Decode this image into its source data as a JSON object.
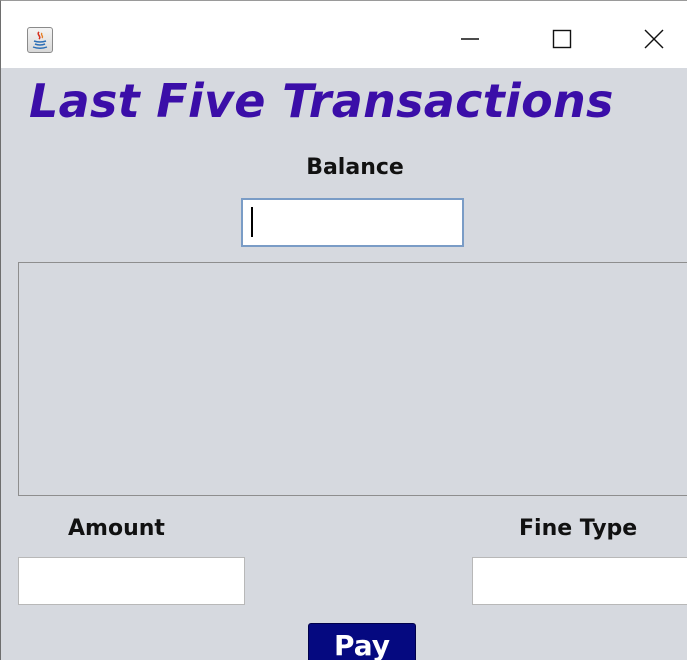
{
  "window": {
    "title": "",
    "app_icon": "java-icon",
    "controls": {
      "minimize": "minimize-icon",
      "maximize": "maximize-icon",
      "close": "close-icon"
    }
  },
  "main": {
    "heading": "Last Five Transactions",
    "heading_color": "#3b0ea8",
    "balance": {
      "label": "Balance",
      "value": "",
      "placeholder": ""
    },
    "transactions": {
      "items": []
    },
    "amount": {
      "label": "Amount",
      "value": "",
      "placeholder": ""
    },
    "fine_type": {
      "label": "Fine Type",
      "value": "",
      "placeholder": ""
    },
    "pay_button": {
      "label": "Pay",
      "color": "#050980"
    }
  }
}
